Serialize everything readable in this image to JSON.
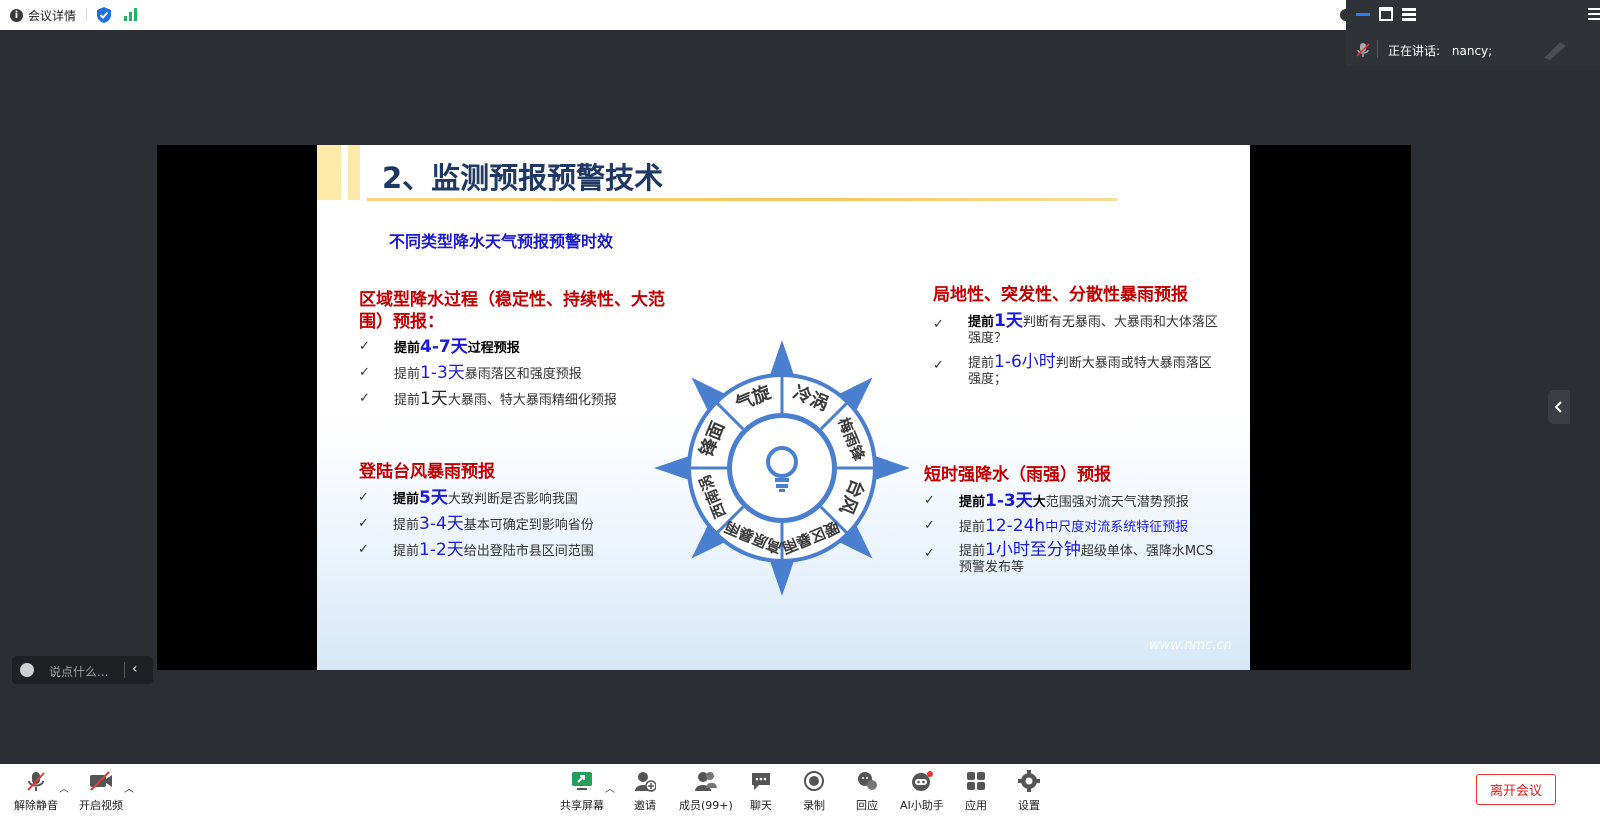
{
  "topbar": {
    "meeting_info": "会议详情"
  },
  "speaker": {
    "label": "正在讲话:",
    "name": "nancy;"
  },
  "slide": {
    "title": "2、监测预报预警技术",
    "subtitle": "不同类型降水天气预报预警时效",
    "regional": {
      "heading_line1": "区域型降水过程（稳定性、持续性、大范",
      "heading_line2": "围）预报：",
      "items": [
        {
          "prefix": "提前",
          "value": "4-7天",
          "text": "过程预报"
        },
        {
          "prefix": "提前",
          "value": "1-3天",
          "text": "暴雨落区和强度预报"
        },
        {
          "prefix": "提前",
          "value": "1天",
          "text": "大暴雨、特大暴雨精细化预报"
        }
      ]
    },
    "typhoon": {
      "heading": "登陆台风暴雨预报",
      "items": [
        {
          "prefix": "提前",
          "value": "5天",
          "text": "大致判断是否影响我国"
        },
        {
          "prefix": "提前",
          "value": "3-4天",
          "text": "基本可确定到影响省份"
        },
        {
          "prefix": "提前",
          "value": "1-2天",
          "text": "给出登陆市县区间范围"
        }
      ]
    },
    "local": {
      "heading": "局地性、突发性、分散性暴雨预报",
      "items": [
        {
          "prefix": "提前",
          "value": "1天",
          "text": "判断有无暴雨、大暴雨和大体落区",
          "text2": "强度？"
        },
        {
          "prefix": "提前",
          "value": "1-6小时",
          "text": "判断大暴雨或特大暴雨落区",
          "text2": "强度；"
        }
      ]
    },
    "shortterm": {
      "heading": "短时强降水（雨强）预报",
      "items": [
        {
          "prefix": "提前",
          "value": "1-3天",
          "text": "大范围强对流天气潜势预报"
        },
        {
          "prefix": "提前",
          "value": "12-24h",
          "text": "中尺度对流系统特征预报"
        },
        {
          "prefix": "提前",
          "value": "1小时至分钟",
          "text": "超级单体、强降水MCS",
          "text2": "预警发布等"
        }
      ]
    },
    "wheel": {
      "segments": [
        "气旋",
        "冷涡",
        "梅雨锋",
        "台风",
        "暖区暴雨",
        "高原暴雨",
        "西南涡",
        "锋面"
      ]
    },
    "watermark": "www.nmc.cn",
    "colors": {
      "heading_red": "#c00000",
      "blue": "#1a1ad8",
      "wheel_blue": "#4a7fd0"
    }
  },
  "chat": {
    "placeholder": "说点什么..."
  },
  "toolbar": {
    "unmute": "解除静音",
    "start_video": "开启视频",
    "share": "共享屏幕",
    "invite": "邀请",
    "members": "成员(99+)",
    "chat": "聊天",
    "record": "录制",
    "react": "回应",
    "ai": "AI小助手",
    "apps": "应用",
    "settings": "设置",
    "leave": "离开会议"
  }
}
